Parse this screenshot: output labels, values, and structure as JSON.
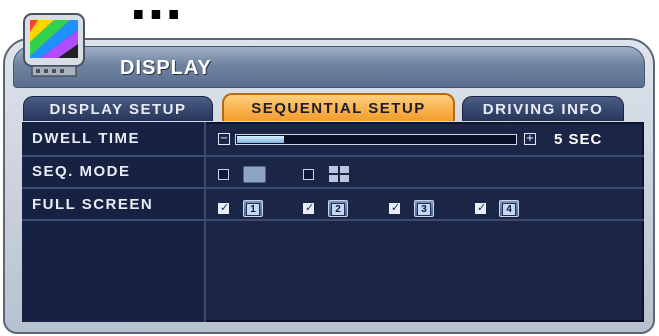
{
  "top_caption": "...",
  "window": {
    "title": "DISPLAY",
    "icon": "monitor-color-bars-icon"
  },
  "tabs": [
    {
      "label": "DISPLAY SETUP",
      "active": false
    },
    {
      "label": "SEQUENTIAL SETUP",
      "active": true
    },
    {
      "label": "DRIVING INFO",
      "active": false
    }
  ],
  "rows": {
    "dwell_time": {
      "label": "DWELL TIME",
      "value": "5 SEC",
      "slider_level": 0.17,
      "decrement_icon": "minus-icon",
      "increment_icon": "plus-icon"
    },
    "seq_mode": {
      "label": "SEQ. MODE",
      "options": [
        {
          "icon": "single-view-icon",
          "checked": false
        },
        {
          "icon": "quad-view-icon",
          "checked": false
        }
      ]
    },
    "full_screen": {
      "label": "FULL SCREEN",
      "channels": [
        {
          "label": "1",
          "checked": true
        },
        {
          "label": "2",
          "checked": true
        },
        {
          "label": "3",
          "checked": true
        },
        {
          "label": "4",
          "checked": true
        }
      ]
    }
  },
  "colors": {
    "active_tab": "#f39b2a",
    "panel_bg": "#1b2647",
    "titlebar": "#6f83a0"
  }
}
